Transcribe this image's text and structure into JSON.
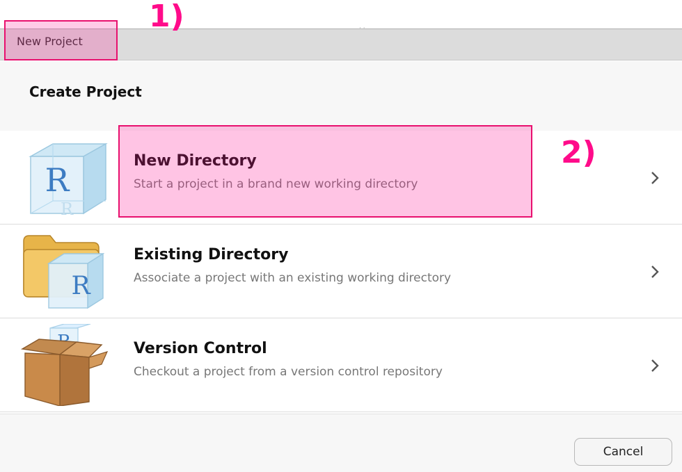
{
  "window": {
    "title": "New Project"
  },
  "header": {
    "title": "Create Project"
  },
  "options": [
    {
      "title": "New Directory",
      "description": "Start a project in a brand new working directory",
      "icon": "r-cube-icon"
    },
    {
      "title": "Existing Directory",
      "description": "Associate a project with an existing working directory",
      "icon": "folder-r-icon"
    },
    {
      "title": "Version Control",
      "description": "Checkout a project from a version control repository",
      "icon": "box-r-icon"
    }
  ],
  "footer": {
    "cancel_label": "Cancel"
  },
  "annotations": {
    "step1": "1)",
    "step2": "2)"
  },
  "colors": {
    "annotation": "#ff0b8a",
    "highlight": "rgba(255,20,147,0.25)",
    "background": "#ffffff",
    "chrome": "#dcdcdc"
  }
}
